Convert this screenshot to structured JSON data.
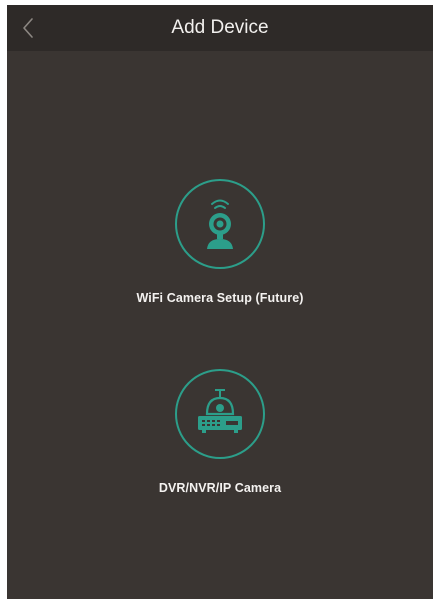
{
  "header": {
    "title": "Add Device",
    "back_icon": "chevron-left-icon"
  },
  "options": [
    {
      "label": "WiFi Camera Setup (Future)",
      "icon": "wifi-camera-icon"
    },
    {
      "label": "DVR/NVR/IP Camera",
      "icon": "dvr-recorder-icon"
    }
  ],
  "colors": {
    "background": "#3a3532",
    "header_background": "#2e2a28",
    "accent": "#2c9e8a",
    "text": "#f2f0ee"
  }
}
